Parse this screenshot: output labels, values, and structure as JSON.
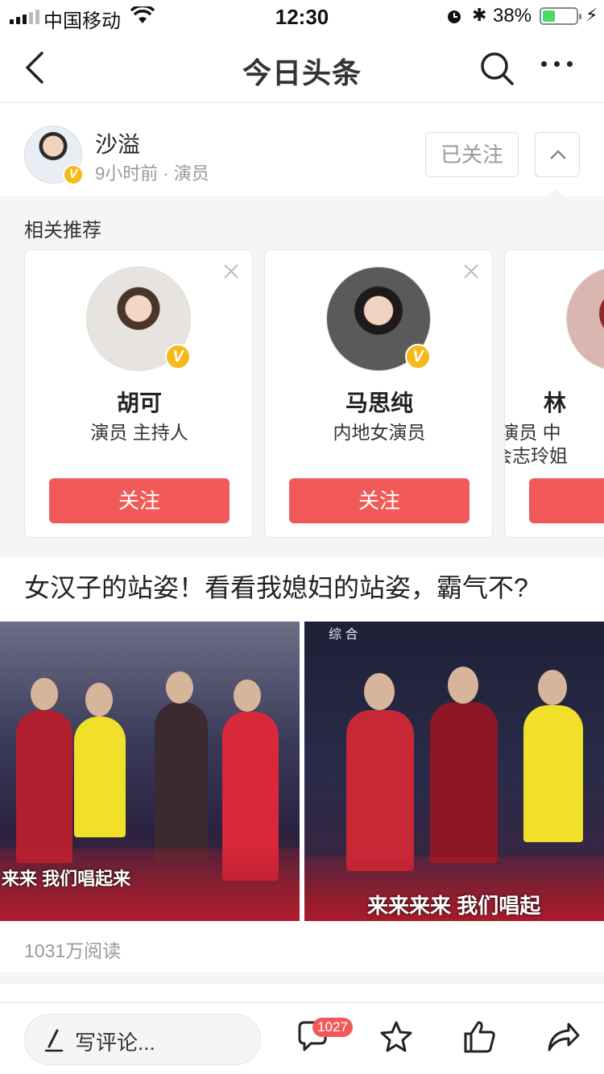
{
  "status_bar": {
    "carrier": "中国移动",
    "time": "12:30",
    "battery_percent": "38%",
    "battery_level": 0.38,
    "icons": [
      "signal-icon",
      "wifi-icon",
      "alarm-icon",
      "bluetooth-icon",
      "battery-icon",
      "charging-icon"
    ]
  },
  "nav": {
    "title": "今日头条",
    "icons": [
      "back-icon",
      "search-icon",
      "more-icon"
    ]
  },
  "author": {
    "name": "沙溢",
    "meta": "9小时前 · 演员",
    "verified_badge": "V",
    "follow_state": "已关注"
  },
  "recommend": {
    "title": "相关推荐",
    "cards": [
      {
        "name": "胡可",
        "desc": "演员 主持人",
        "follow_label": "关注",
        "badge": "V"
      },
      {
        "name": "马思纯",
        "desc": "内地女演员",
        "follow_label": "关注",
        "badge": "V"
      },
      {
        "name": "林",
        "desc": "演员 中\n会志玲姐",
        "follow_label": "关",
        "badge": ""
      }
    ]
  },
  "post": {
    "title": "女汉子的站姿！看看我媳妇的站姿，霸气不?",
    "image_left_caption": "来来 我们唱起来",
    "image_right_caption": "来来来来 我们唱起",
    "image_right_logo": "综 合",
    "reads": "1031万阅读"
  },
  "bottom_bar": {
    "comment_placeholder": "写评论...",
    "comment_count": "1027",
    "icons": [
      "pen-icon",
      "comment-icon",
      "star-icon",
      "like-icon",
      "share-icon"
    ]
  },
  "colors": {
    "accent": "#f25a5a",
    "verified": "#f5b91a",
    "battery_fill": "#4cd964"
  }
}
